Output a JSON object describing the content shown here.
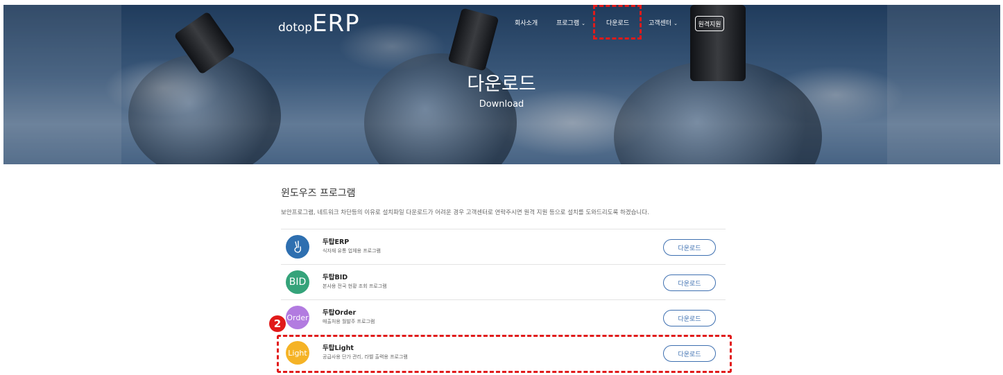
{
  "header": {
    "logo_small": "dotop",
    "logo_big": "ERP",
    "nav": {
      "company": "회사소개",
      "program": "프로그램",
      "download": "다운로드",
      "support": "고객센터",
      "remote": "원격지원"
    },
    "hero_title": "다운로드",
    "hero_subtitle": "Download"
  },
  "section": {
    "title": "윈도우즈 프로그램",
    "description": "보안프로그램, 네트워크 차단등의 이유로 설치파일 다운로드가 어려운 경우 고객센터로 연락주시면 원격 지원 등으로 설치를 도와드리도록 하겠습니다."
  },
  "programs": [
    {
      "name": "두탑ERP",
      "desc": "식자재 유통 업체용 프로그램",
      "icon": "hand-icon",
      "icon_text": "",
      "color": "#2e6fb0",
      "button": "다운로드"
    },
    {
      "name": "두탑BID",
      "desc": "본사용 전국 현황 조회 프로그램",
      "icon": "bid-icon",
      "icon_text": "BID",
      "color": "#35a37a",
      "button": "다운로드"
    },
    {
      "name": "두탑Order",
      "desc": "매출처용 월발주 프로그램",
      "icon": "order-icon",
      "icon_text": "Order",
      "color": "#b27be0",
      "button": "다운로드"
    },
    {
      "name": "두탑Light",
      "desc": "공급사용 단가 관리, 라벨 출력용 프로그램",
      "icon": "light-icon",
      "icon_text": "Light",
      "color": "#f5b326",
      "button": "다운로드"
    }
  ],
  "annotation": {
    "badge": "2",
    "color": "#e11a1a"
  }
}
